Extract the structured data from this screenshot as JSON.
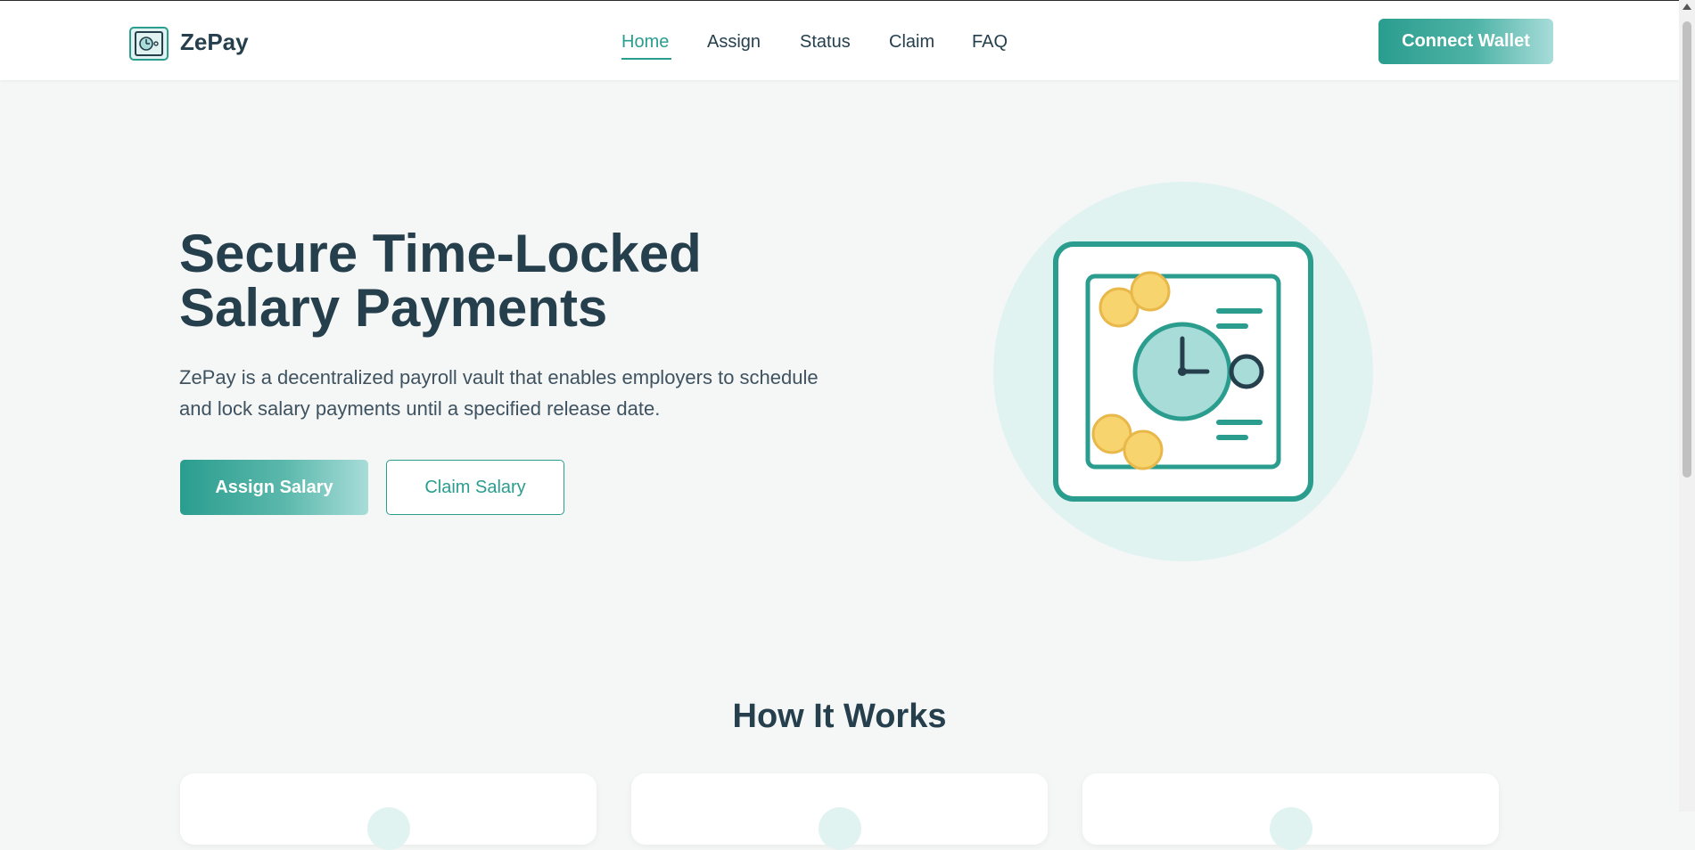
{
  "header": {
    "brand": "ZePay",
    "nav": [
      {
        "label": "Home",
        "active": true
      },
      {
        "label": "Assign",
        "active": false
      },
      {
        "label": "Status",
        "active": false
      },
      {
        "label": "Claim",
        "active": false
      },
      {
        "label": "FAQ",
        "active": false
      }
    ],
    "connect_label": "Connect Wallet"
  },
  "hero": {
    "title_line1": "Secure Time-Locked",
    "title_line2": "Salary Payments",
    "description": "ZePay is a decentralized payroll vault that enables employers to schedule and lock salary payments until a specified release date.",
    "primary_label": "Assign Salary",
    "secondary_label": "Claim Salary"
  },
  "how_it_works": {
    "title": "How It Works",
    "cards": 3
  },
  "icons": {
    "logo": "vault-clock-icon",
    "illustration": "time-locked-vault-illustration"
  },
  "colors": {
    "accent": "#2a9d8f",
    "accent_light": "#a8dcd9",
    "text_dark": "#263f4d",
    "background": "#f5f7f6",
    "coin": "#f7d46e",
    "illustration_circle": "#e1f3f1"
  }
}
